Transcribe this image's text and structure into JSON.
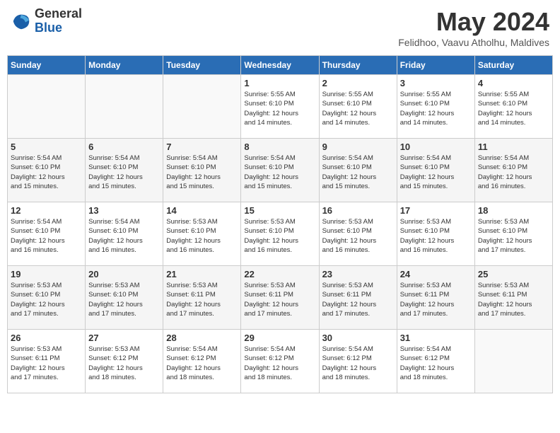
{
  "logo": {
    "general": "General",
    "blue": "Blue"
  },
  "title": "May 2024",
  "subtitle": "Felidhoo, Vaavu Atholhu, Maldives",
  "days_of_week": [
    "Sunday",
    "Monday",
    "Tuesday",
    "Wednesday",
    "Thursday",
    "Friday",
    "Saturday"
  ],
  "weeks": [
    [
      {
        "day": "",
        "info": ""
      },
      {
        "day": "",
        "info": ""
      },
      {
        "day": "",
        "info": ""
      },
      {
        "day": "1",
        "info": "Sunrise: 5:55 AM\nSunset: 6:10 PM\nDaylight: 12 hours\nand 14 minutes."
      },
      {
        "day": "2",
        "info": "Sunrise: 5:55 AM\nSunset: 6:10 PM\nDaylight: 12 hours\nand 14 minutes."
      },
      {
        "day": "3",
        "info": "Sunrise: 5:55 AM\nSunset: 6:10 PM\nDaylight: 12 hours\nand 14 minutes."
      },
      {
        "day": "4",
        "info": "Sunrise: 5:55 AM\nSunset: 6:10 PM\nDaylight: 12 hours\nand 14 minutes."
      }
    ],
    [
      {
        "day": "5",
        "info": "Sunrise: 5:54 AM\nSunset: 6:10 PM\nDaylight: 12 hours\nand 15 minutes."
      },
      {
        "day": "6",
        "info": "Sunrise: 5:54 AM\nSunset: 6:10 PM\nDaylight: 12 hours\nand 15 minutes."
      },
      {
        "day": "7",
        "info": "Sunrise: 5:54 AM\nSunset: 6:10 PM\nDaylight: 12 hours\nand 15 minutes."
      },
      {
        "day": "8",
        "info": "Sunrise: 5:54 AM\nSunset: 6:10 PM\nDaylight: 12 hours\nand 15 minutes."
      },
      {
        "day": "9",
        "info": "Sunrise: 5:54 AM\nSunset: 6:10 PM\nDaylight: 12 hours\nand 15 minutes."
      },
      {
        "day": "10",
        "info": "Sunrise: 5:54 AM\nSunset: 6:10 PM\nDaylight: 12 hours\nand 15 minutes."
      },
      {
        "day": "11",
        "info": "Sunrise: 5:54 AM\nSunset: 6:10 PM\nDaylight: 12 hours\nand 16 minutes."
      }
    ],
    [
      {
        "day": "12",
        "info": "Sunrise: 5:54 AM\nSunset: 6:10 PM\nDaylight: 12 hours\nand 16 minutes."
      },
      {
        "day": "13",
        "info": "Sunrise: 5:54 AM\nSunset: 6:10 PM\nDaylight: 12 hours\nand 16 minutes."
      },
      {
        "day": "14",
        "info": "Sunrise: 5:53 AM\nSunset: 6:10 PM\nDaylight: 12 hours\nand 16 minutes."
      },
      {
        "day": "15",
        "info": "Sunrise: 5:53 AM\nSunset: 6:10 PM\nDaylight: 12 hours\nand 16 minutes."
      },
      {
        "day": "16",
        "info": "Sunrise: 5:53 AM\nSunset: 6:10 PM\nDaylight: 12 hours\nand 16 minutes."
      },
      {
        "day": "17",
        "info": "Sunrise: 5:53 AM\nSunset: 6:10 PM\nDaylight: 12 hours\nand 16 minutes."
      },
      {
        "day": "18",
        "info": "Sunrise: 5:53 AM\nSunset: 6:10 PM\nDaylight: 12 hours\nand 17 minutes."
      }
    ],
    [
      {
        "day": "19",
        "info": "Sunrise: 5:53 AM\nSunset: 6:10 PM\nDaylight: 12 hours\nand 17 minutes."
      },
      {
        "day": "20",
        "info": "Sunrise: 5:53 AM\nSunset: 6:10 PM\nDaylight: 12 hours\nand 17 minutes."
      },
      {
        "day": "21",
        "info": "Sunrise: 5:53 AM\nSunset: 6:11 PM\nDaylight: 12 hours\nand 17 minutes."
      },
      {
        "day": "22",
        "info": "Sunrise: 5:53 AM\nSunset: 6:11 PM\nDaylight: 12 hours\nand 17 minutes."
      },
      {
        "day": "23",
        "info": "Sunrise: 5:53 AM\nSunset: 6:11 PM\nDaylight: 12 hours\nand 17 minutes."
      },
      {
        "day": "24",
        "info": "Sunrise: 5:53 AM\nSunset: 6:11 PM\nDaylight: 12 hours\nand 17 minutes."
      },
      {
        "day": "25",
        "info": "Sunrise: 5:53 AM\nSunset: 6:11 PM\nDaylight: 12 hours\nand 17 minutes."
      }
    ],
    [
      {
        "day": "26",
        "info": "Sunrise: 5:53 AM\nSunset: 6:11 PM\nDaylight: 12 hours\nand 17 minutes."
      },
      {
        "day": "27",
        "info": "Sunrise: 5:53 AM\nSunset: 6:12 PM\nDaylight: 12 hours\nand 18 minutes."
      },
      {
        "day": "28",
        "info": "Sunrise: 5:54 AM\nSunset: 6:12 PM\nDaylight: 12 hours\nand 18 minutes."
      },
      {
        "day": "29",
        "info": "Sunrise: 5:54 AM\nSunset: 6:12 PM\nDaylight: 12 hours\nand 18 minutes."
      },
      {
        "day": "30",
        "info": "Sunrise: 5:54 AM\nSunset: 6:12 PM\nDaylight: 12 hours\nand 18 minutes."
      },
      {
        "day": "31",
        "info": "Sunrise: 5:54 AM\nSunset: 6:12 PM\nDaylight: 12 hours\nand 18 minutes."
      },
      {
        "day": "",
        "info": ""
      }
    ]
  ]
}
